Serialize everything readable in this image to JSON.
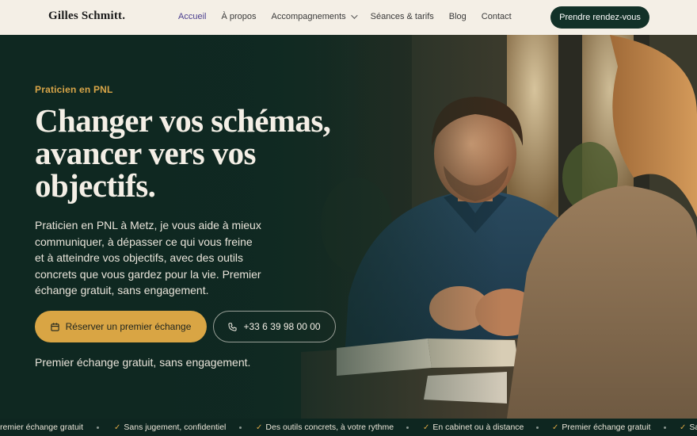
{
  "header": {
    "logo": "Gilles Schmitt.",
    "nav": [
      {
        "label": "Accueil",
        "active": true
      },
      {
        "label": "À propos"
      },
      {
        "label": "Accompagnements",
        "dropdown": true
      },
      {
        "label": "Séances & tarifs"
      },
      {
        "label": "Blog"
      },
      {
        "label": "Contact"
      }
    ],
    "cta": "Prendre rendez-vous"
  },
  "hero": {
    "eyebrow": "Praticien en PNL",
    "title_lines": [
      "Changer vos schémas,",
      "avancer vers vos",
      "objectifs."
    ],
    "lead": "Praticien en PNL à Metz, je vous aide à mieux communiquer, à dépasser ce qui vous freine et à atteindre vos objectifs, avec des outils concrets que vous gardez pour la vie. Premier échange gratuit, sans engagement.",
    "primary_button": {
      "label": "Réserver un premier échange",
      "icon": "calendar-icon"
    },
    "secondary_button": {
      "label": "+33 6 39 98 00 00",
      "icon": "phone-icon"
    },
    "note": "Premier échange gratuit, sans engagement."
  },
  "ticker": {
    "items": [
      {
        "label": "remier échange gratuit",
        "check": false
      },
      {
        "label": "Sans jugement, confidentiel",
        "check": true
      },
      {
        "label": "Des outils concrets, à votre rythme",
        "check": true
      },
      {
        "label": "En cabinet ou à distance",
        "check": true
      },
      {
        "label": "Premier échange gratuit",
        "check": true
      },
      {
        "label": "Sa",
        "check": true
      }
    ]
  },
  "colors": {
    "accent": "#d9a544",
    "dark_green": "#0f2a23",
    "cream": "#f4efe6",
    "nav_active": "#4b3f8f"
  }
}
